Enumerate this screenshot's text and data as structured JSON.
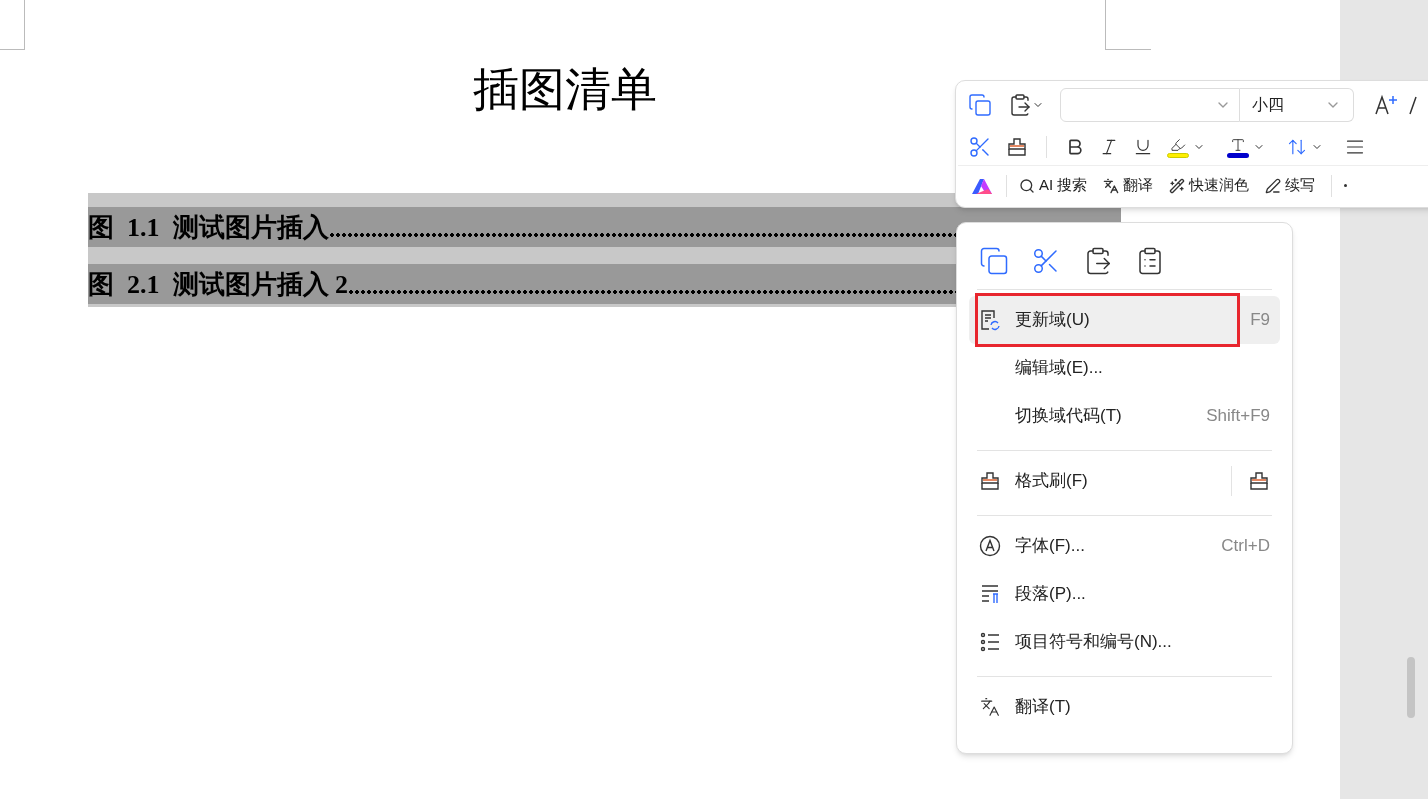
{
  "document": {
    "title": "插图清单",
    "entries": [
      {
        "label": "图  1.1  测试图片插入"
      },
      {
        "label": "图  2.1  测试图片插入 2"
      }
    ]
  },
  "toolbar": {
    "font_size": "小四",
    "ai_actions": [
      {
        "kind": "search",
        "label": "AI 搜索"
      },
      {
        "kind": "translate",
        "label": "翻译"
      },
      {
        "kind": "polish",
        "label": "快速润色"
      },
      {
        "kind": "continue",
        "label": "续写"
      }
    ]
  },
  "context_menu": {
    "sections": [
      [
        {
          "kind": "update",
          "label": "更新域(U)",
          "shortcut": "F9",
          "selected": true,
          "annotated": true
        },
        {
          "kind": "none",
          "label": "编辑域(E)...",
          "selected": false,
          "annotated": false
        },
        {
          "kind": "none",
          "label": "切换域代码(T)",
          "shortcut": "Shift+F9",
          "selected": false,
          "annotated": false
        }
      ],
      [
        {
          "kind": "brush",
          "label": "格式刷(F)",
          "selected": false,
          "annotated": false,
          "lock_button": true
        }
      ],
      [
        {
          "kind": "font",
          "label": "字体(F)...",
          "shortcut": "Ctrl+D",
          "selected": false,
          "annotated": false
        },
        {
          "kind": "paragraph",
          "label": "段落(P)...",
          "selected": false,
          "annotated": false
        },
        {
          "kind": "list",
          "label": "项目符号和编号(N)...",
          "selected": false,
          "annotated": false
        }
      ],
      [
        {
          "kind": "translate",
          "label": "翻译(T)",
          "selected": false,
          "annotated": false
        }
      ]
    ]
  }
}
